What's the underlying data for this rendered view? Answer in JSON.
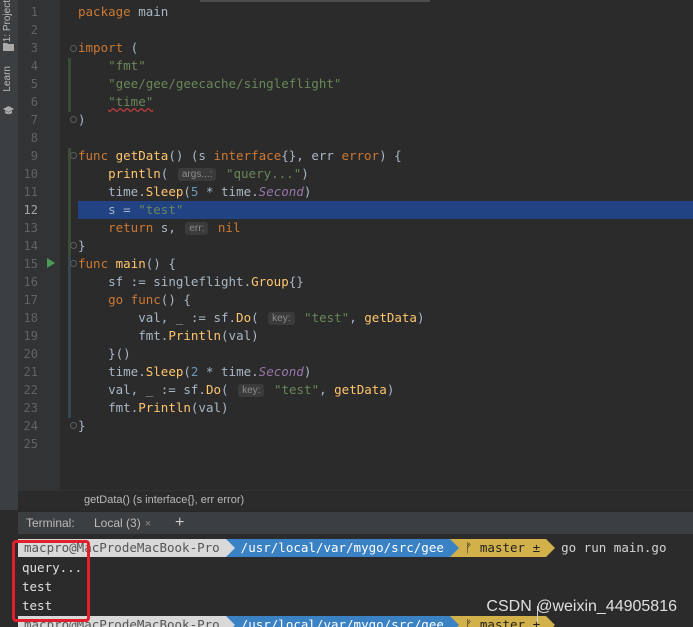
{
  "side_tabs": [
    {
      "label": "1: Project",
      "icon": "folder-icon"
    },
    {
      "label": "Learn",
      "icon": "graduation-cap-icon"
    }
  ],
  "code_lines": [
    {
      "n": "1",
      "html": "<span class='kw'>package</span> main"
    },
    {
      "n": "2",
      "html": ""
    },
    {
      "n": "3",
      "html": "<span class='kw'>import</span> ("
    },
    {
      "n": "4",
      "html": "    <span class='str'>\"fmt\"</span>"
    },
    {
      "n": "5",
      "html": "    <span class='str'>\"gee/gee/geecache/singleflight\"</span>"
    },
    {
      "n": "6",
      "html": "    <span class='str err'>\"time\"</span>"
    },
    {
      "n": "7",
      "html": ")"
    },
    {
      "n": "8",
      "html": ""
    },
    {
      "n": "9",
      "html": "<span class='kw'>func</span> <span class='fn'>getData</span>() (s <span class='kw'>interface</span>{}, err <span class='kw'>error</span>) {"
    },
    {
      "n": "10",
      "html": "    <span class='fn'>println</span>( <span class='hint'>args...:</span> <span class='str'>\"query...\"</span>)"
    },
    {
      "n": "11",
      "html": "    <span class='pkg'>time</span>.<span class='fn'>Sleep</span>(<span class='num'>5</span> * <span class='pkg'>time</span>.<span class='it'>Second</span>)"
    },
    {
      "n": "12",
      "html": "    s = <span class='str'>\"test\"</span>",
      "hl": true
    },
    {
      "n": "13",
      "html": "    <span class='kw'>return</span> s, <span class='hint'>err:</span> <span class='kw'>nil</span>"
    },
    {
      "n": "14",
      "html": "}"
    },
    {
      "n": "15",
      "html": "<span class='kw'>func</span> <span class='fn'>main</span>() {"
    },
    {
      "n": "16",
      "html": "    sf := <span class='pkg'>singleflight</span>.<span class='fn'>Group</span>{}"
    },
    {
      "n": "17",
      "html": "    <span class='kw'>go func</span>() {"
    },
    {
      "n": "18",
      "html": "        val, _ := sf.<span class='fn'>Do</span>( <span class='hint'>key:</span> <span class='str'>\"test\"</span>, <span class='fn'>getData</span>)"
    },
    {
      "n": "19",
      "html": "        <span class='pkg'>fmt</span>.<span class='fn'>Println</span>(val)"
    },
    {
      "n": "20",
      "html": "    }()"
    },
    {
      "n": "21",
      "html": "    <span class='pkg'>time</span>.<span class='fn'>Sleep</span>(<span class='num'>2</span> * <span class='pkg'>time</span>.<span class='it'>Second</span>)"
    },
    {
      "n": "22",
      "html": "    val, _ := sf.<span class='fn'>Do</span>( <span class='hint'>key:</span> <span class='str'>\"test\"</span>, <span class='fn'>getData</span>)"
    },
    {
      "n": "23",
      "html": "    <span class='pkg'>fmt</span>.<span class='fn'>Println</span>(val)"
    },
    {
      "n": "24",
      "html": "}"
    },
    {
      "n": "25",
      "html": ""
    }
  ],
  "breadcrumb": "getData() (s interface{}, err error)",
  "terminal": {
    "label": "Terminal:",
    "tab": "Local (3)",
    "close": "×",
    "add": "+",
    "prompt_user": "macpro@MacProdeMacBook-Pro",
    "prompt_path": "/usr/local/var/mygo/src/gee",
    "prompt_git": "ᚠ master ±",
    "command": "go run main.go",
    "output": [
      "query...",
      "test",
      "test"
    ]
  },
  "watermark": "CSDN @weixin_44905816",
  "colors": {
    "editor_bg": "#2b2b2b",
    "highlight": "#214283",
    "keyword": "#cc7832",
    "function": "#ffc66d",
    "string": "#6a8759",
    "path_segment": "#3a82c4",
    "git_segment": "#d2b14b",
    "annotation_box": "#e0202c"
  }
}
